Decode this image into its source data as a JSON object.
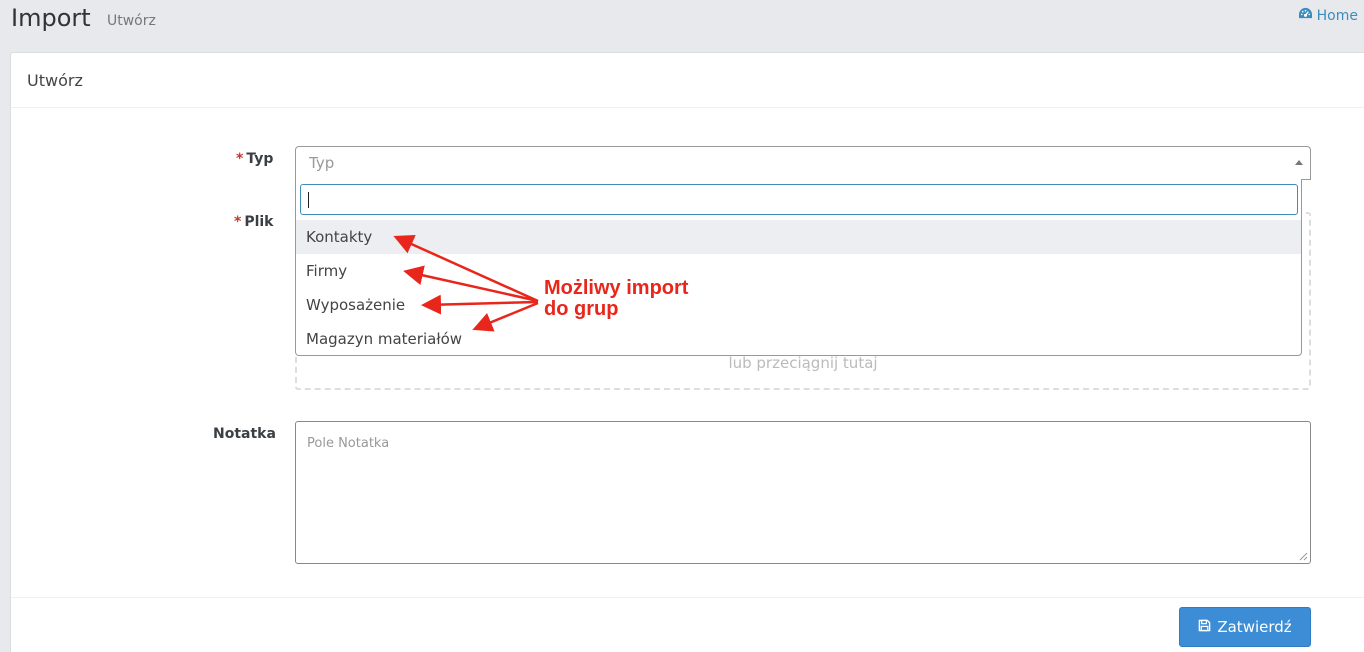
{
  "header": {
    "title": "Import",
    "subtitle": "Utwórz",
    "home_label": "Home"
  },
  "card": {
    "title": "Utwórz"
  },
  "form": {
    "typ_label": "Typ",
    "plik_label": "Plik",
    "notatka_label": "Notatka",
    "required_mark": "*",
    "typ_placeholder": "Typ",
    "dropzone_text": "lub przeciągnij tutaj",
    "notatka_placeholder": "Pole Notatka",
    "submit_label": "Zatwierdź"
  },
  "dropdown": {
    "search_value": "",
    "options": [
      "Kontakty",
      "Firmy",
      "Wyposażenie",
      "Magazyn materiałów"
    ],
    "highlighted": "Kontakty"
  },
  "annotation": {
    "line1": "Możliwy import",
    "line2": "do grup",
    "color": "#e8261b"
  },
  "colors": {
    "accent": "#3c8dd6",
    "link": "#3c8dbc",
    "required": "#c0392b"
  },
  "icons": {
    "home": "dashboard-icon",
    "submit": "save-icon",
    "select": "caret-up-icon"
  }
}
